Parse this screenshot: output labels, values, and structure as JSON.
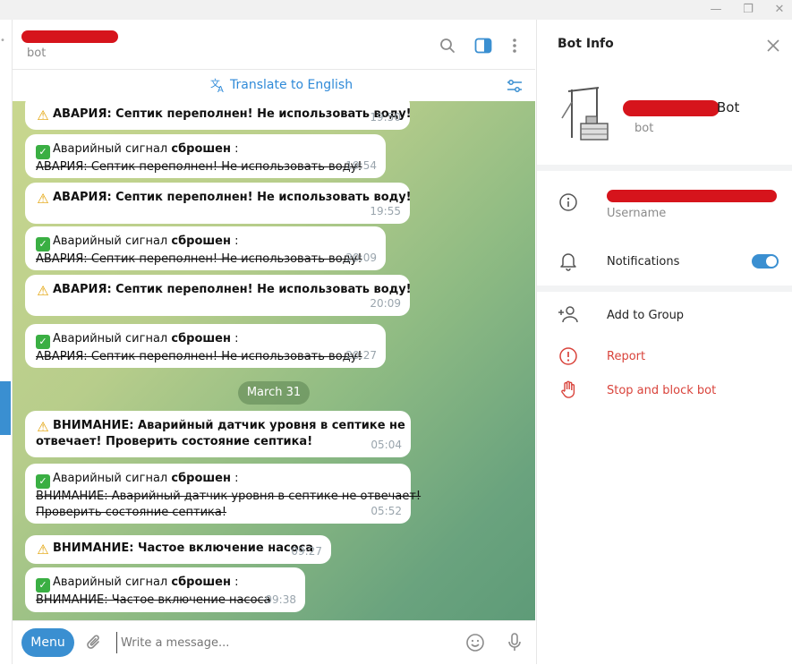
{
  "window": {
    "minimize_icon": "minimize-icon",
    "maximize_icon": "maximize-icon",
    "close_icon": "close-icon"
  },
  "chat": {
    "subtitle": "bot",
    "translate_label": "Translate to English",
    "date_separator": "March 31",
    "messages": [
      {
        "kind": "alarm",
        "prefix": "",
        "bold": "АВАРИЯ: Септик переполнен! Не использовать воду!",
        "time": "19:50"
      },
      {
        "kind": "reset",
        "head": "Аварийный сигнал ",
        "head_bold": "сброшен",
        "head_tail": " :",
        "struck": "АВАРИЯ: Септик переполнен! Не использовать воду!",
        "time": "19:54"
      },
      {
        "kind": "alarm",
        "bold": "АВАРИЯ: Септик переполнен! Не использовать воду!",
        "time": "19:55"
      },
      {
        "kind": "reset",
        "head": "Аварийный сигнал ",
        "head_bold": "сброшен",
        "head_tail": " :",
        "struck": "АВАРИЯ: Септик переполнен! Не использовать воду!",
        "time": "20:09"
      },
      {
        "kind": "alarm",
        "bold": "АВАРИЯ: Септик переполнен! Не использовать воду!",
        "time": "20:09"
      },
      {
        "kind": "reset",
        "head": "Аварийный сигнал ",
        "head_bold": "сброшен",
        "head_tail": " :",
        "struck": "АВАРИЯ: Септик переполнен! Не использовать воду!",
        "time": "20:27"
      },
      {
        "kind": "alarm2",
        "line1": "ВНИМАНИЕ: Аварийный датчик уровня в септике не",
        "line2": "отвечает! Проверить состояние септика!",
        "time": "05:04"
      },
      {
        "kind": "reset2",
        "head": "Аварийный сигнал ",
        "head_bold": "сброшен",
        "head_tail": " :",
        "struck1": "ВНИМАНИЕ: Аварийный датчик уровня в септике не отвечает!",
        "struck2": "Проверить состояние септика!",
        "time": "05:52"
      },
      {
        "kind": "alarm",
        "bold": "ВНИМАНИЕ: Частое включение насоса",
        "time": "09:27"
      },
      {
        "kind": "reset",
        "head": "Аварийный сигнал ",
        "head_bold": "сброшен",
        "head_tail": " :",
        "struck": "ВНИМАНИЕ: Частое включение насоса",
        "time": "09:38"
      }
    ]
  },
  "composer": {
    "menu_label": "Menu",
    "placeholder": "Write a message..."
  },
  "bot_info": {
    "title": "Bot Info",
    "name_suffix": "Bot",
    "subtitle": "bot",
    "username_label": "Username",
    "notifications_label": "Notifications",
    "notifications_on": true,
    "add_to_group": "Add to Group",
    "report": "Report",
    "stop_block": "Stop and block bot"
  },
  "colors": {
    "accent": "#3a8fd1",
    "danger": "#d9433b",
    "redaction": "#d6141c"
  }
}
